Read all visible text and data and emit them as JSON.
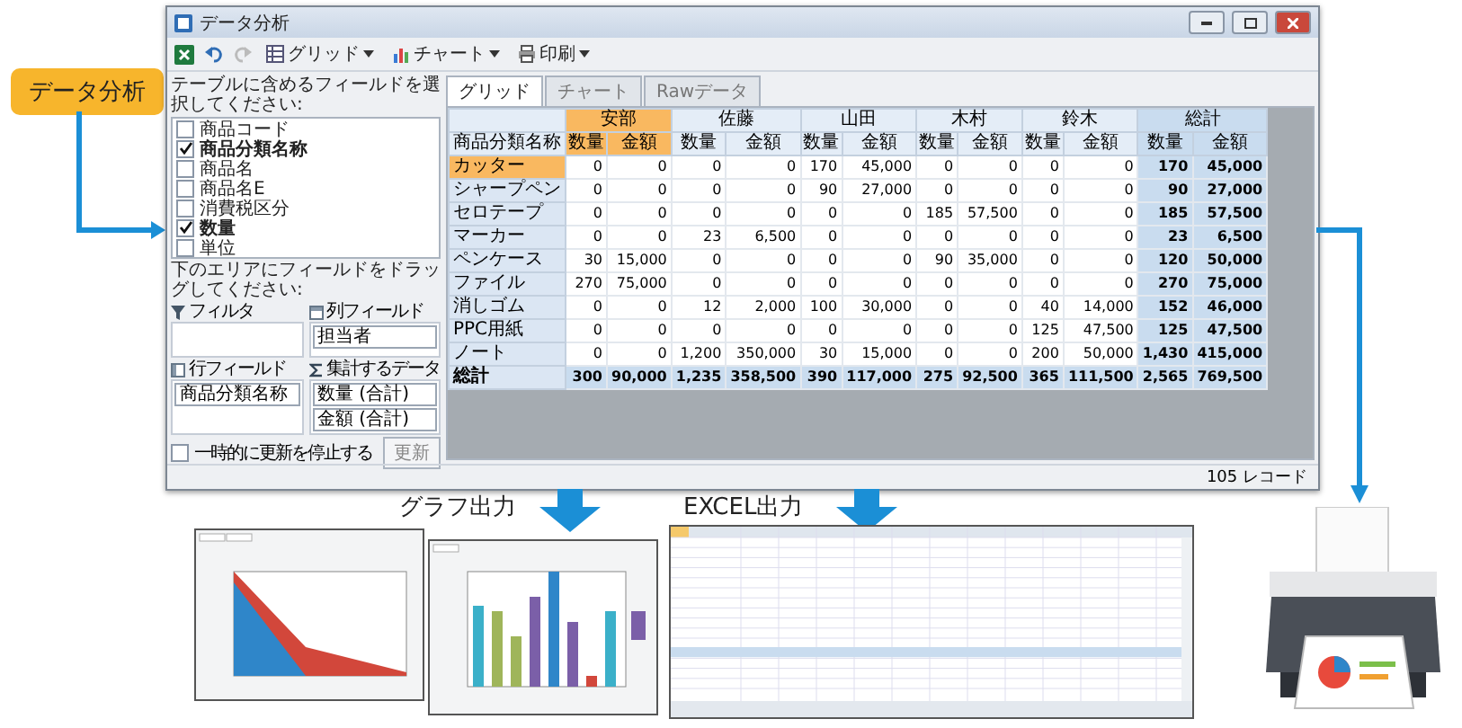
{
  "badge": {
    "label": "データ分析"
  },
  "window": {
    "title": "データ分析",
    "toolbar": [
      {
        "label": "グリッド",
        "disabled": false
      },
      {
        "label": "チャート",
        "disabled": false
      },
      {
        "label": "印刷",
        "disabled": false
      }
    ],
    "field_list": {
      "label": "テーブルに含めるフィールドを選択してください:",
      "items": [
        {
          "label": "商品コード",
          "checked": false
        },
        {
          "label": "商品分類名称",
          "checked": true
        },
        {
          "label": "商品名",
          "checked": false
        },
        {
          "label": "商品名E",
          "checked": false
        },
        {
          "label": "消費税区分",
          "checked": false
        },
        {
          "label": "数量",
          "checked": true
        },
        {
          "label": "単位",
          "checked": false
        }
      ]
    },
    "areas_label": "下のエリアにフィールドをドラッグしてください:",
    "areas": [
      {
        "kind": "filter",
        "label": "フィルタ"
      },
      {
        "kind": "column",
        "label": "列フィールド",
        "items": [
          "担当者"
        ]
      },
      {
        "kind": "row",
        "label": "行フィールド",
        "items": [
          "商品分類名称"
        ]
      },
      {
        "kind": "sum",
        "label": "集計するデータ",
        "items": [
          "数量 (合計)",
          "金額 (合計)"
        ]
      }
    ],
    "defer": {
      "label": "一時的に更新を停止する",
      "checked": false
    },
    "update_button": "更新",
    "tabs": [
      {
        "label": "グリッド",
        "selected": true
      },
      {
        "label": "チャート",
        "selected": false
      },
      {
        "label": "Rawデータ",
        "selected": false
      }
    ],
    "table": {
      "corner": "商品分類名称",
      "groups": [
        {
          "name": "安部",
          "kind": "normal",
          "selected": true,
          "subcolumns": [
            "数量",
            "金額"
          ]
        },
        {
          "name": "佐藤",
          "kind": "normal",
          "selected": false,
          "subcolumns": [
            "数量",
            "金額"
          ]
        },
        {
          "name": "山田",
          "kind": "normal",
          "selected": false,
          "subcolumns": [
            "数量",
            "金額"
          ]
        },
        {
          "name": "木村",
          "kind": "normal",
          "selected": false,
          "subcolumns": [
            "数量",
            "金額"
          ]
        },
        {
          "name": "鈴木",
          "kind": "normal",
          "selected": false,
          "subcolumns": [
            "数量",
            "金額"
          ]
        },
        {
          "name": "総計",
          "kind": "total",
          "selected": false,
          "subcolumns": [
            "数量",
            "金額"
          ]
        }
      ],
      "rows": [
        {
          "label": "カッター",
          "kind": "normal",
          "selected": true,
          "cells": [
            "0",
            "0",
            "0",
            "0",
            "170",
            "45,000",
            "0",
            "0",
            "0",
            "0",
            "170",
            "45,000"
          ]
        },
        {
          "label": "シャープペン",
          "kind": "normal",
          "selected": false,
          "cells": [
            "0",
            "0",
            "0",
            "0",
            "90",
            "27,000",
            "0",
            "0",
            "0",
            "0",
            "90",
            "27,000"
          ]
        },
        {
          "label": "セロテープ",
          "kind": "normal",
          "selected": false,
          "cells": [
            "0",
            "0",
            "0",
            "0",
            "0",
            "0",
            "185",
            "57,500",
            "0",
            "0",
            "185",
            "57,500"
          ]
        },
        {
          "label": "マーカー",
          "kind": "normal",
          "selected": false,
          "cells": [
            "0",
            "0",
            "23",
            "6,500",
            "0",
            "0",
            "0",
            "0",
            "0",
            "0",
            "23",
            "6,500"
          ]
        },
        {
          "label": "ペンケース",
          "kind": "normal",
          "selected": false,
          "cells": [
            "30",
            "15,000",
            "0",
            "0",
            "0",
            "0",
            "90",
            "35,000",
            "0",
            "0",
            "120",
            "50,000"
          ]
        },
        {
          "label": "ファイル",
          "kind": "normal",
          "selected": false,
          "cells": [
            "270",
            "75,000",
            "0",
            "0",
            "0",
            "0",
            "0",
            "0",
            "0",
            "0",
            "270",
            "75,000"
          ]
        },
        {
          "label": "消しゴム",
          "kind": "normal",
          "selected": false,
          "cells": [
            "0",
            "0",
            "12",
            "2,000",
            "100",
            "30,000",
            "0",
            "0",
            "40",
            "14,000",
            "152",
            "46,000"
          ]
        },
        {
          "label": "PPC用紙",
          "kind": "normal",
          "selected": false,
          "cells": [
            "0",
            "0",
            "0",
            "0",
            "0",
            "0",
            "0",
            "0",
            "125",
            "47,500",
            "125",
            "47,500"
          ]
        },
        {
          "label": "ノート",
          "kind": "normal",
          "selected": false,
          "cells": [
            "0",
            "0",
            "1,200",
            "350,000",
            "30",
            "15,000",
            "0",
            "0",
            "200",
            "50,000",
            "1,430",
            "415,000"
          ]
        },
        {
          "label": "総計",
          "kind": "total",
          "selected": false,
          "cells": [
            "300",
            "90,000",
            "1,235",
            "358,500",
            "390",
            "117,000",
            "275",
            "92,500",
            "365",
            "111,500",
            "2,565",
            "769,500"
          ]
        }
      ]
    },
    "status": "105 レコード"
  },
  "outputs": [
    {
      "label": "グラフ出力"
    },
    {
      "label": "EXCEL出力"
    }
  ]
}
